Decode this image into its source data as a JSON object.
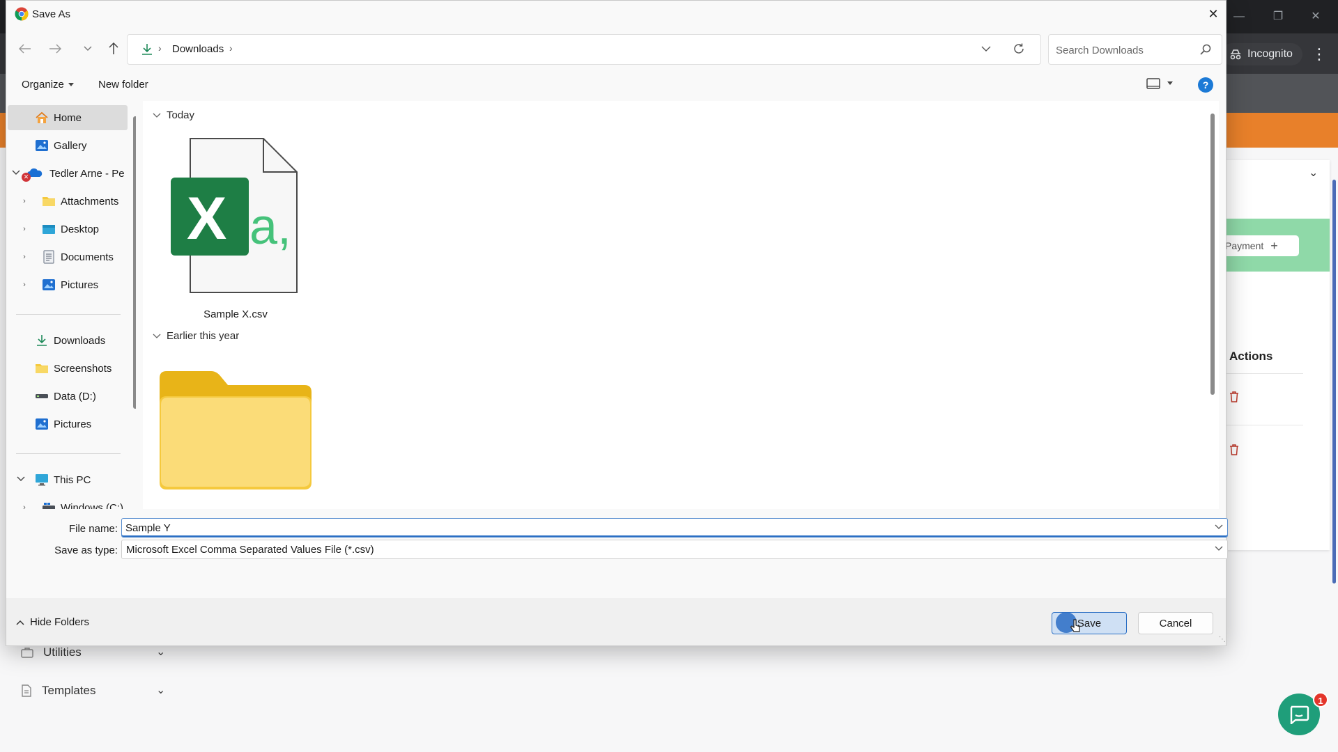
{
  "background": {
    "incognito_label": "Incognito",
    "payment_label": "Payment",
    "actions_label": "Actions",
    "nav_items": [
      {
        "label": "Utilities",
        "icon": "briefcase-icon"
      },
      {
        "label": "Templates",
        "icon": "document-icon"
      }
    ],
    "chat_badge": "1"
  },
  "dialog": {
    "title": "Save As",
    "address": {
      "crumbs": [
        "Downloads"
      ]
    },
    "search": {
      "placeholder": "Search Downloads"
    },
    "toolbar": {
      "organize_label": "Organize",
      "new_folder_label": "New folder"
    },
    "nav": {
      "items": [
        {
          "label": "Home",
          "icon": "home-icon",
          "selected": true
        },
        {
          "label": "Gallery",
          "icon": "gallery-icon"
        },
        {
          "label": "Tedler Arne - Pe",
          "icon": "onedrive-icon",
          "expanded": true
        },
        {
          "label": "Attachments",
          "icon": "folder-icon"
        },
        {
          "label": "Desktop",
          "icon": "desktop-icon"
        },
        {
          "label": "Documents",
          "icon": "documents-icon"
        },
        {
          "label": "Pictures",
          "icon": "pictures-icon"
        },
        {
          "label": "Downloads",
          "icon": "download-icon"
        },
        {
          "label": "Screenshots",
          "icon": "folder-icon"
        },
        {
          "label": "Data (D:)",
          "icon": "drive-icon"
        },
        {
          "label": "Pictures",
          "icon": "pictures-icon"
        },
        {
          "label": "This PC",
          "icon": "pc-icon",
          "expanded": true
        },
        {
          "label": "Windows (C:)",
          "icon": "windows-drive-icon"
        }
      ]
    },
    "groups": [
      {
        "label": "Today",
        "files": [
          {
            "name": "Sample X.csv",
            "icon": "excel-csv-icon"
          }
        ]
      },
      {
        "label": "Earlier this year",
        "files": [
          {
            "name": "",
            "icon": "folder-icon"
          }
        ]
      }
    ],
    "file_name_label": "File name:",
    "file_name_value": "Sample Y",
    "save_type_label": "Save as type:",
    "save_type_value": "Microsoft Excel Comma Separated Values File (*.csv)",
    "hide_folders_label": "Hide Folders",
    "save_label": "Save",
    "cancel_label": "Cancel",
    "colors": {
      "accent": "#2b6fc4",
      "excel_green": "#1e7e45",
      "folder_yellow": "#f5c93d"
    }
  }
}
